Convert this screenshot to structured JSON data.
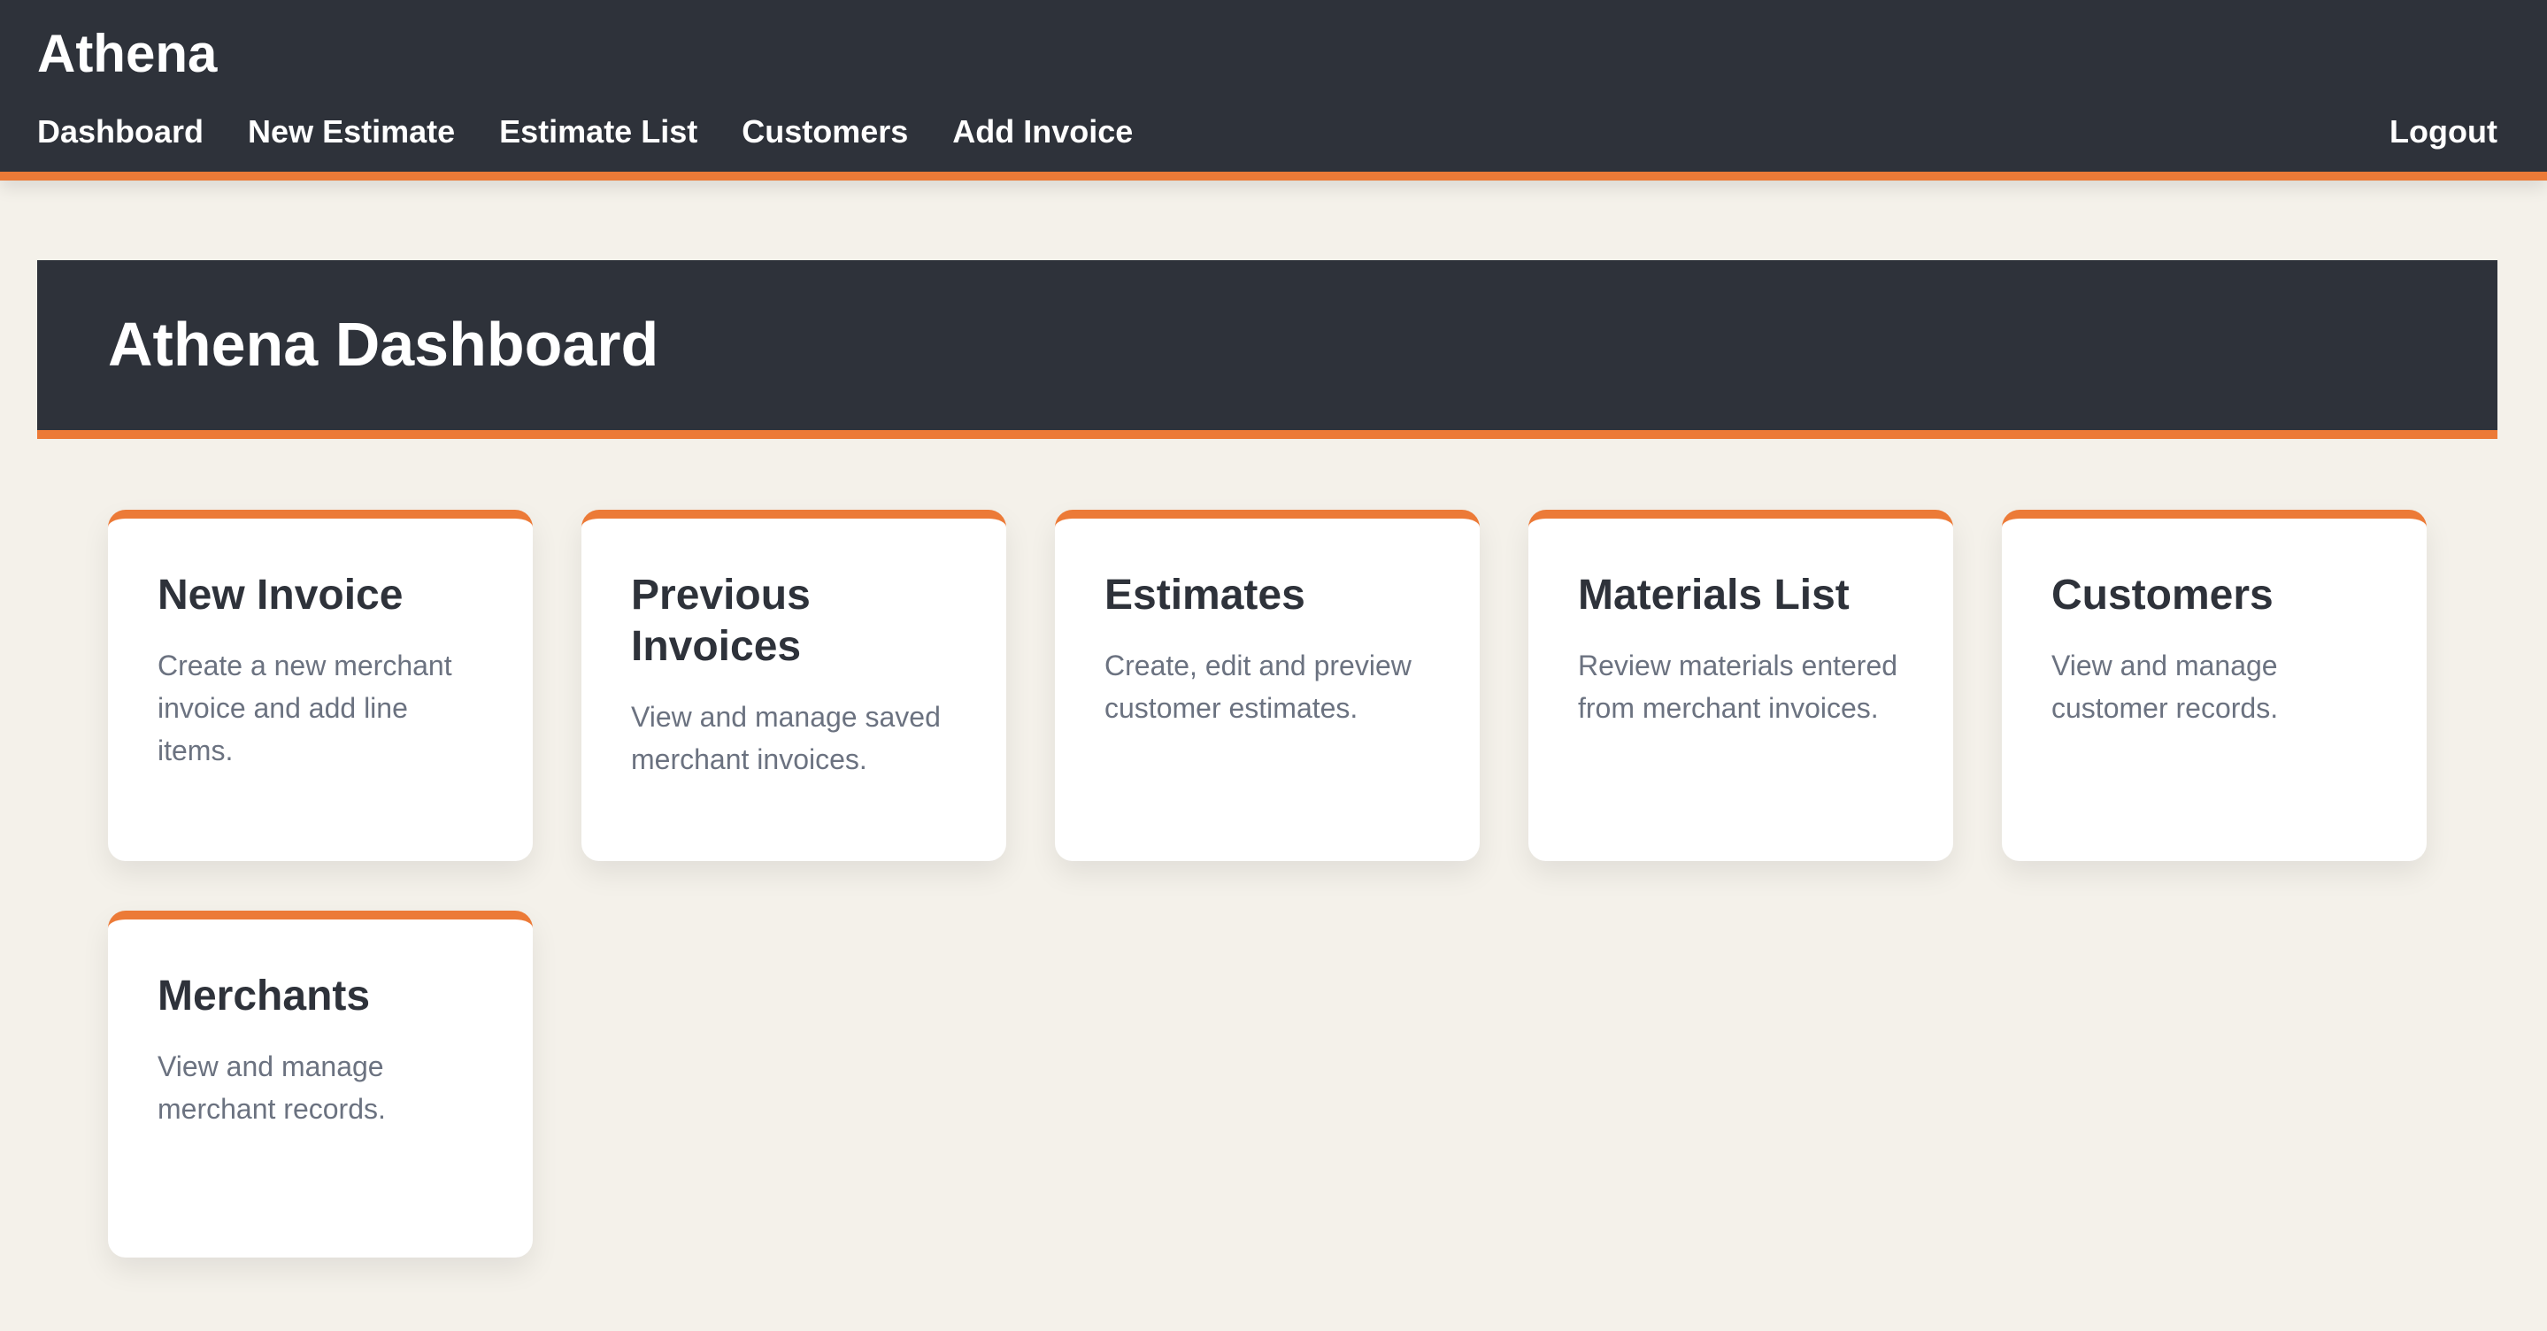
{
  "app": {
    "brand": "Athena"
  },
  "nav": {
    "items": [
      {
        "label": "Dashboard"
      },
      {
        "label": "New Estimate"
      },
      {
        "label": "Estimate List"
      },
      {
        "label": "Customers"
      },
      {
        "label": "Add Invoice"
      }
    ],
    "logout_label": "Logout"
  },
  "page": {
    "title": "Athena Dashboard"
  },
  "cards": [
    {
      "title": "New Invoice",
      "description": "Create a new merchant invoice and add line items."
    },
    {
      "title": "Previous Invoices",
      "description": "View and manage saved merchant invoices."
    },
    {
      "title": "Estimates",
      "description": "Create, edit and preview customer estimates."
    },
    {
      "title": "Materials List",
      "description": "Review materials entered from merchant invoices."
    },
    {
      "title": "Customers",
      "description": "View and manage customer records."
    },
    {
      "title": "Merchants",
      "description": "View and manage merchant records."
    }
  ],
  "colors": {
    "header_bg": "#2e323a",
    "accent": "#ec7a37",
    "page_bg": "#f4f1ea",
    "card_bg": "#ffffff",
    "muted_text": "#6b7280"
  }
}
